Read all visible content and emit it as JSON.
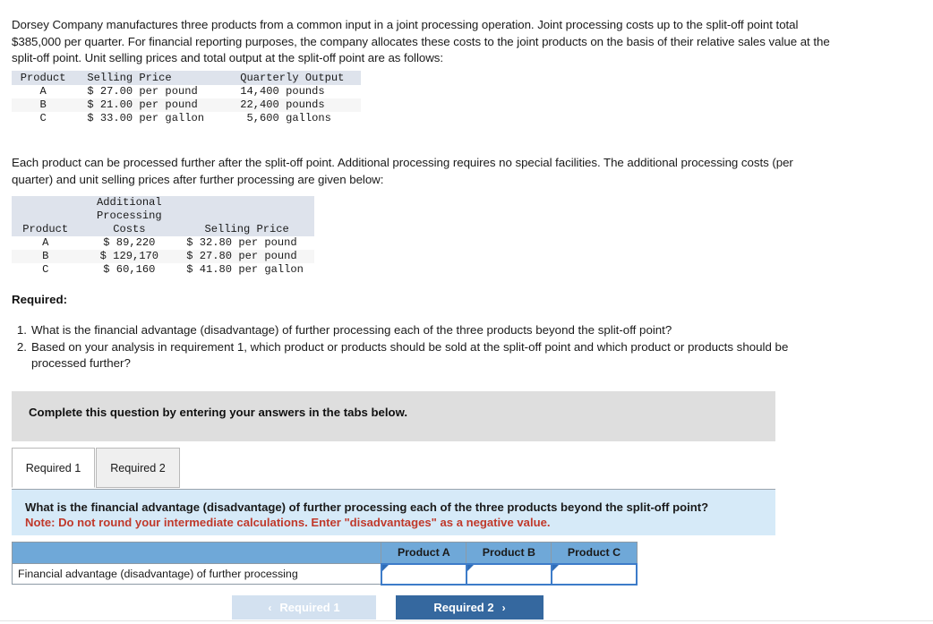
{
  "intro": {
    "paragraph": "Dorsey Company manufactures three products from a common input in a joint processing operation. Joint processing costs up to the split-off point total $385,000 per quarter. For financial reporting purposes, the company allocates these costs to the joint products on the basis of their relative sales value at the split-off point. Unit selling prices and total output at the split-off point are as follows:",
    "middle_paragraph": "Each product can be processed further after the split-off point. Additional processing requires no special facilities. The additional processing costs (per quarter) and unit selling prices after further processing are given below:"
  },
  "table_one": {
    "headers": [
      "Product",
      "Selling Price",
      "Quarterly Output"
    ],
    "rows": [
      {
        "product": "A",
        "selling_price": "$ 27.00 per pound",
        "quarterly_output": "14,400 pounds"
      },
      {
        "product": "B",
        "selling_price": "$ 21.00 per pound",
        "quarterly_output": "22,400 pounds"
      },
      {
        "product": "C",
        "selling_price": "$ 33.00 per gallon",
        "quarterly_output": " 5,600 gallons"
      }
    ]
  },
  "table_two": {
    "header_line_1": "Additional",
    "header_line_2": "Processing",
    "headers": [
      "Product",
      "Costs",
      "Selling Price"
    ],
    "rows": [
      {
        "product": "A",
        "additional_cost": "$ 89,220",
        "selling_price": "$ 32.80 per pound"
      },
      {
        "product": "B",
        "additional_cost": "$ 129,170",
        "selling_price": "$ 27.80 per pound"
      },
      {
        "product": "C",
        "additional_cost": "$ 60,160",
        "selling_price": "$ 41.80 per gallon"
      }
    ]
  },
  "required": {
    "heading": "Required:",
    "items": [
      {
        "num": "1.",
        "text": "What is the financial advantage (disadvantage) of further processing each of the three products beyond the split-off point?"
      },
      {
        "num": "2.",
        "text": "Based on your analysis in requirement 1, which product or products should be sold at the split-off point and which product or products should be processed further?"
      }
    ]
  },
  "banner": {
    "text": "Complete this question by entering your answers in the tabs below."
  },
  "tabs": [
    {
      "label": "Required 1",
      "active": true
    },
    {
      "label": "Required 2",
      "active": false
    }
  ],
  "instruction": {
    "question": "What is the financial advantage (disadvantage) of further processing each of the three products beyond the split-off point?",
    "note": "Note: Do not round your intermediate calculations. Enter \"disadvantages\" as a negative value."
  },
  "answer_grid": {
    "blank_header": "",
    "column_headers": [
      "Product A",
      "Product B",
      "Product C"
    ],
    "row_label": "Financial advantage (disadvantage) of further processing",
    "values": [
      "",
      "",
      ""
    ]
  },
  "nav": {
    "prev_label": "Required 1",
    "prev_icon": "chevron-left-icon",
    "prev_chevron": "‹",
    "next_label": "Required 2",
    "next_icon": "chevron-right-icon",
    "next_chevron": "›"
  },
  "colors": {
    "table_header_blue_gray": "#dee3ec",
    "answer_header_blue": "#6fa8d8",
    "instruction_panel_blue": "#d6eaf8",
    "note_red": "#c0392b",
    "banner_gray": "#dedede",
    "next_button_blue": "#35689f",
    "prev_button_blue": "#d3e1f0",
    "input_border_blue": "#3d7cc9"
  }
}
